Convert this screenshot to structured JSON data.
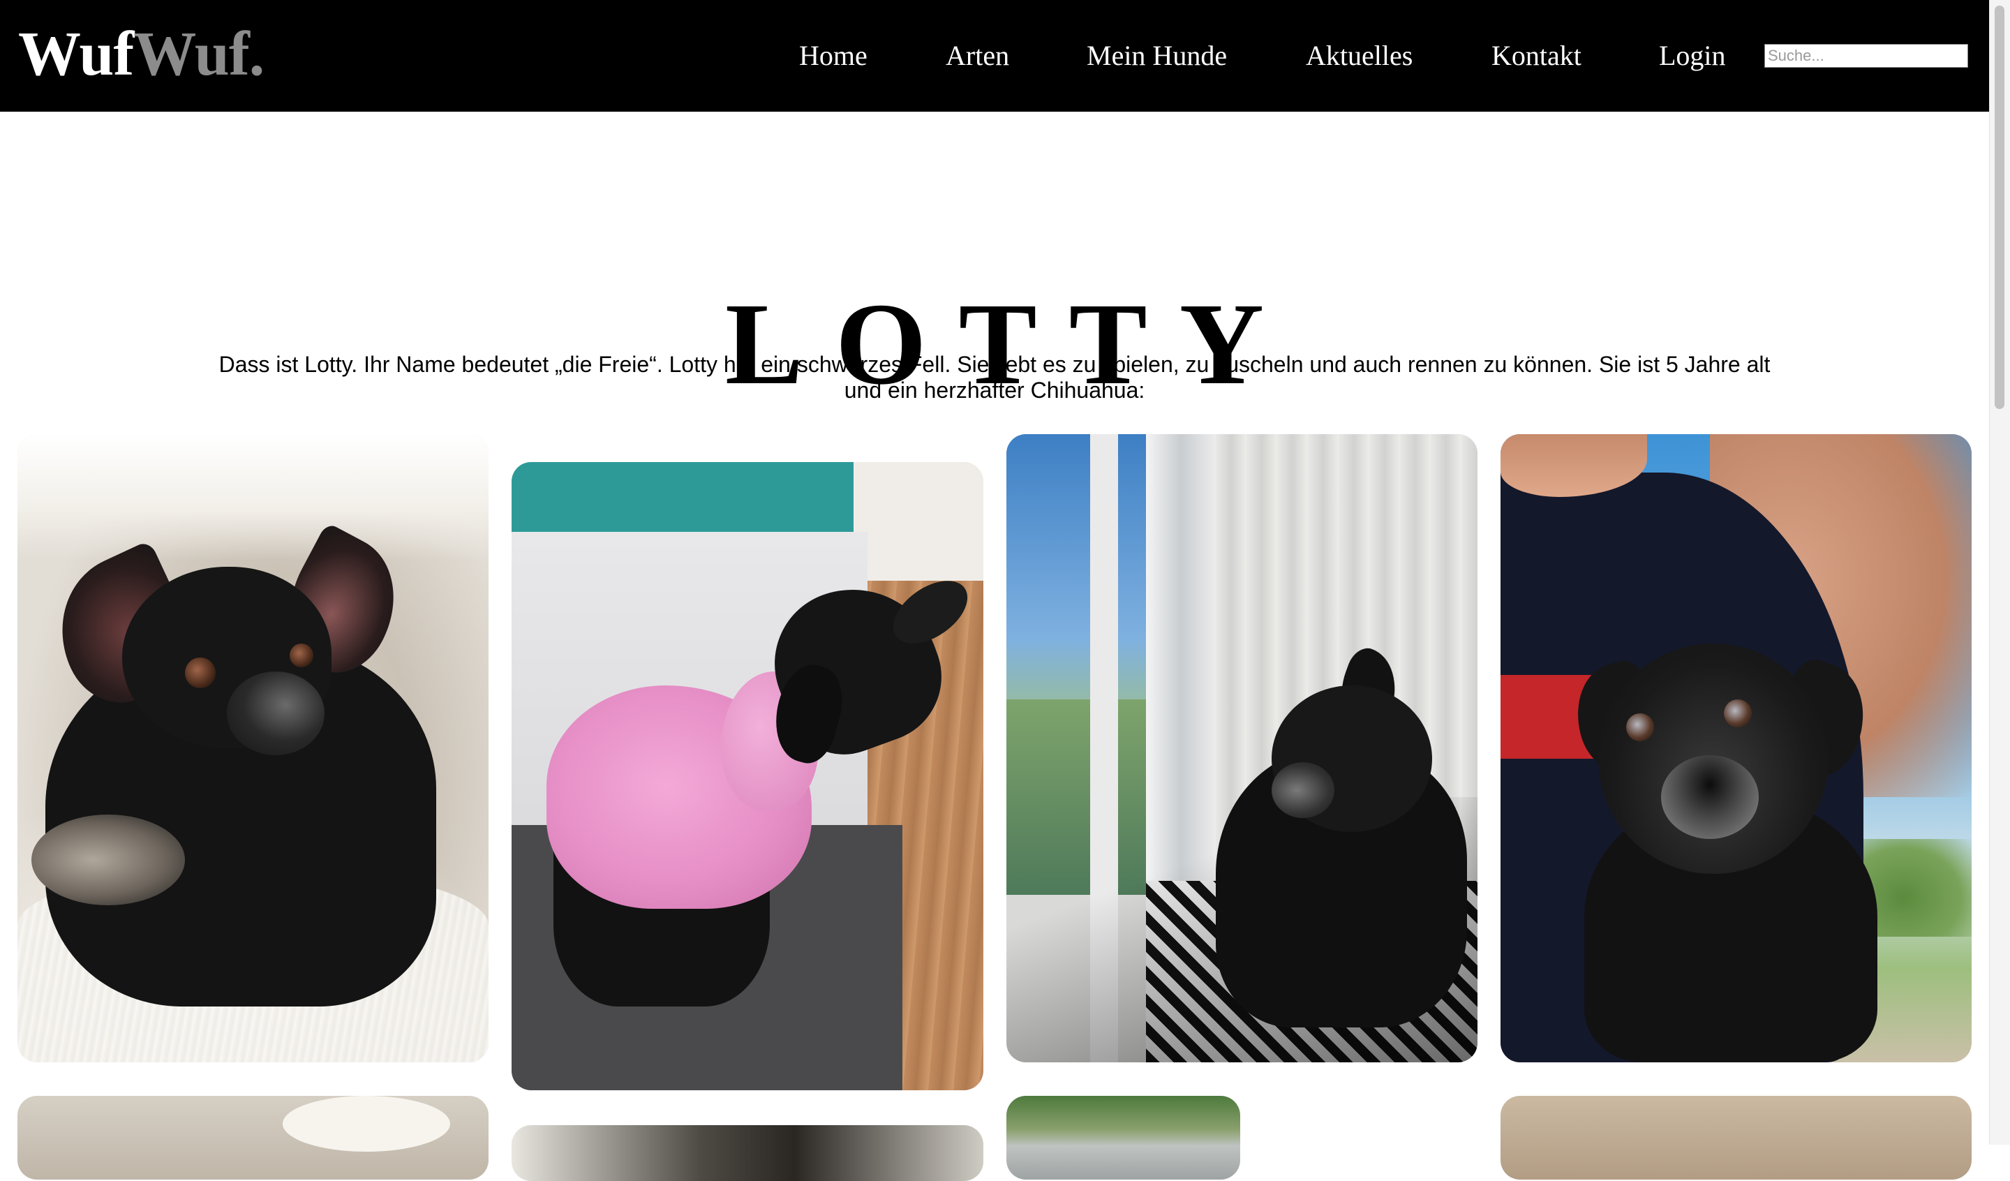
{
  "logo": {
    "part1": "Wuf",
    "part2": "Wuf."
  },
  "nav": {
    "items": [
      {
        "label": "Home"
      },
      {
        "label": "Arten"
      },
      {
        "label": "Mein Hunde"
      },
      {
        "label": "Aktuelles"
      },
      {
        "label": "Kontakt"
      },
      {
        "label": "Login"
      }
    ]
  },
  "search": {
    "placeholder": "Suche...",
    "value": ""
  },
  "main": {
    "title": "LOTTY",
    "description": "Dass ist Lotty. Ihr Name bedeutet „die Freie“. Lotty hat ein schwarzes Fell. Sie liebt es zu spielen, zu kuscheln und auch rennen zu können. Sie ist 5 Jahre alt und ein herzhafter Chihuahua:"
  },
  "colors": {
    "header_bg": "#000000",
    "logo_secondary": "#8c8c8c",
    "page_bg": "#ffffff"
  }
}
